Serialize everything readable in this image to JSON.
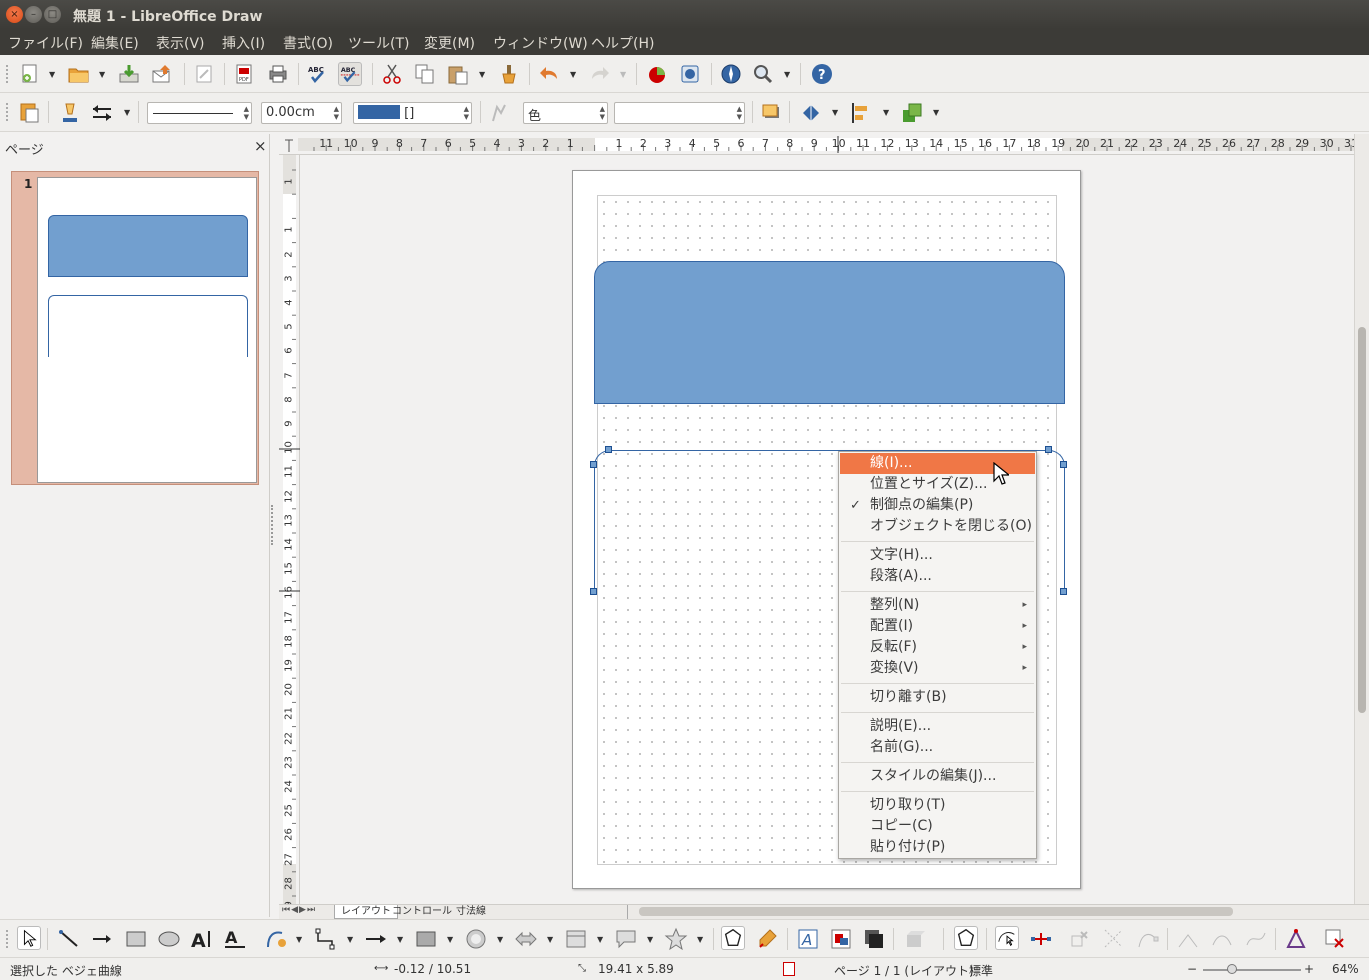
{
  "window": {
    "title": "無題 1 - LibreOffice Draw",
    "close_glyph": "×",
    "min_glyph": "–",
    "max_glyph": "□"
  },
  "menubar": {
    "items": [
      "ファイル(F)",
      "編集(E)",
      "表示(V)",
      "挿入(I)",
      "書式(O)",
      "ツール(T)",
      "変更(M)",
      "ウィンドウ(W)",
      "ヘルプ(H)"
    ]
  },
  "line_toolbar": {
    "line_width": "0.00cm",
    "area_fill_value": "[]",
    "area_style": "色",
    "area_style_value": "",
    "fill_color": "#3465a4"
  },
  "page_pane": {
    "title": "ページ",
    "close_glyph": "×",
    "page_number": "1"
  },
  "rulers": {
    "h_labels": [
      "11",
      "10",
      "9",
      "8",
      "7",
      "6",
      "5",
      "4",
      "3",
      "2",
      "1",
      "",
      "1",
      "2",
      "3",
      "4",
      "5",
      "6",
      "7",
      "8",
      "9",
      "10",
      "11",
      "12",
      "13",
      "14",
      "15",
      "16",
      "17",
      "18",
      "19",
      "20",
      "21",
      "22",
      "23",
      "24",
      "25",
      "26",
      "27",
      "28",
      "29",
      "30",
      "31"
    ],
    "v_labels": [
      "1",
      "",
      "1",
      "2",
      "3",
      "4",
      "5",
      "6",
      "7",
      "8",
      "9",
      "10",
      "11",
      "12",
      "13",
      "14",
      "15",
      "16",
      "17",
      "18",
      "19",
      "20",
      "21",
      "22",
      "23",
      "24",
      "25",
      "26",
      "27",
      "28",
      "29"
    ]
  },
  "layer_tabs": [
    "レイアウト",
    "コントロール",
    "寸法線"
  ],
  "context_menu": {
    "items": [
      {
        "label": "線(I)...",
        "highlighted": true
      },
      {
        "label": "位置とサイズ(Z)..."
      },
      {
        "label": "制御点の編集(P)",
        "checked": true
      },
      {
        "label": "オブジェクトを閉じる(O)"
      },
      {
        "label": "文字(H)..."
      },
      {
        "label": "段落(A)..."
      },
      {
        "label": "整列(N)",
        "submenu": true
      },
      {
        "label": "配置(I)",
        "submenu": true
      },
      {
        "label": "反転(F)",
        "submenu": true
      },
      {
        "label": "変換(V)",
        "submenu": true
      },
      {
        "label": "切り離す(B)"
      },
      {
        "label": "説明(E)..."
      },
      {
        "label": "名前(G)..."
      },
      {
        "label": "スタイルの編集(J)..."
      },
      {
        "label": "切り取り(T)"
      },
      {
        "label": "コピー(C)"
      },
      {
        "label": "貼り付け(P)"
      }
    ],
    "check_glyph": "✓",
    "arrow_glyph": "▸"
  },
  "statusbar": {
    "selection": "選択した ベジェ曲線",
    "position": "-0.12 / 10.51",
    "size": "19.41 x 5.89",
    "page": "ページ 1 / 1 (レイアウト)",
    "style": "標準",
    "zoom_minus": "−",
    "zoom_plus": "+",
    "zoom": "64%",
    "zoom_fraction": 0.3
  },
  "colors": {
    "shape_fill": "#729fcf",
    "shape_border": "#3465a4",
    "menu_highlight": "#f07746"
  }
}
